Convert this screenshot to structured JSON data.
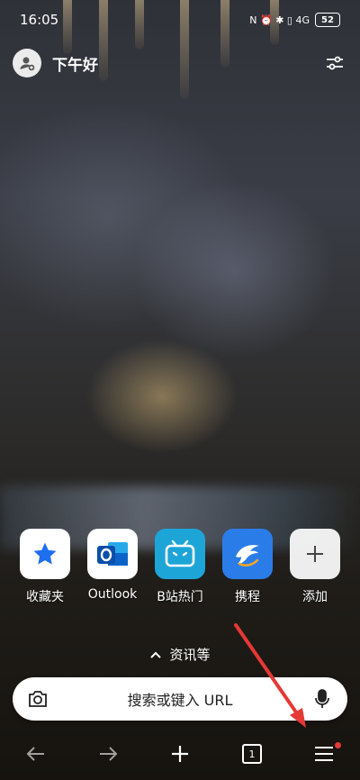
{
  "status_bar": {
    "time": "16:05",
    "icons": "N ⏰ ✱ ▯ 4G",
    "battery": "52"
  },
  "header": {
    "greeting": "下午好"
  },
  "shortcuts": [
    {
      "label": "收藏夹",
      "icon": "star-icon",
      "color": "#1e6ff0",
      "bg": "#ffffff"
    },
    {
      "label": "Outlook",
      "icon": "outlook-icon",
      "color": "#0a64c8",
      "bg": "#ffffff"
    },
    {
      "label": "B站热门",
      "icon": "bilibili-icon",
      "color": "#ffffff",
      "bg": "#1ea5d8"
    },
    {
      "label": "携程",
      "icon": "ctrip-dolphin-icon",
      "color": "#ffffff",
      "bg": "#2a7de9"
    },
    {
      "label": "添加",
      "icon": "plus-icon",
      "color": "#444444",
      "bg": "#ffffff"
    }
  ],
  "news": {
    "label": "资讯等"
  },
  "search": {
    "placeholder": "搜索或键入 URL"
  },
  "bottom_nav": {
    "tab_count": "1"
  },
  "colors": {
    "annotation_arrow": "#e53935",
    "notification_dot": "#e53935"
  }
}
